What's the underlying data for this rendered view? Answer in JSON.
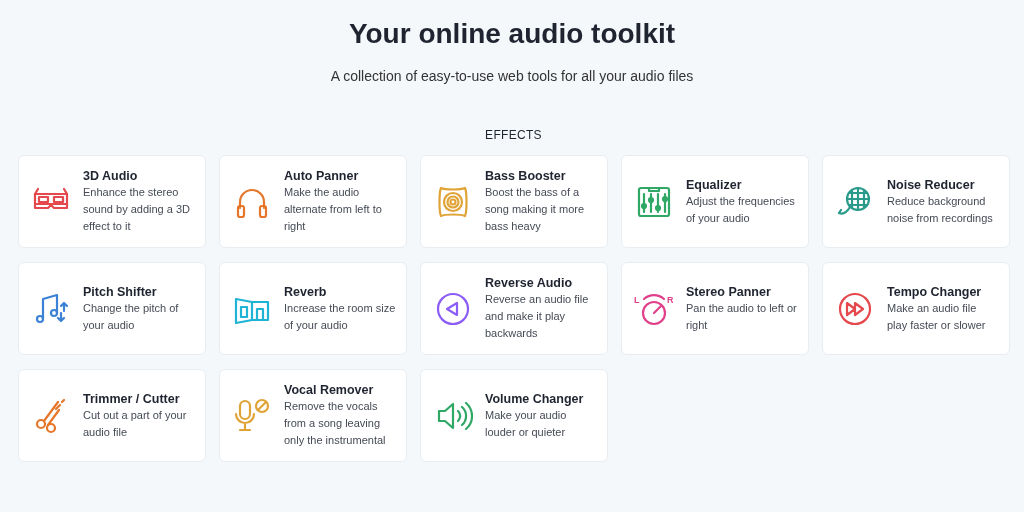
{
  "header": {
    "title": "Your online audio toolkit",
    "subtitle": "A collection of easy-to-use web tools for all your audio files"
  },
  "section": {
    "heading": "EFFECTS",
    "tools": [
      {
        "name": "3D Audio",
        "description": "Enhance the stereo sound by adding a 3D effect to it",
        "kind": "glasses",
        "color": "#e5484d"
      },
      {
        "name": "Auto Panner",
        "description": "Make the audio alternate from left to right",
        "kind": "headphones",
        "color": "#e5762a"
      },
      {
        "name": "Bass Booster",
        "description": "Boost the bass of a song making it more bass heavy",
        "kind": "speaker",
        "color": "#e0a336"
      },
      {
        "name": "Equalizer",
        "description": "Adjust the frequencies of your audio",
        "kind": "mixer",
        "color": "#2fa866"
      },
      {
        "name": "Noise Reducer",
        "description": "Reduce background noise from recordings",
        "kind": "mic-grid",
        "color": "#2a9a8a"
      },
      {
        "name": "Pitch Shifter",
        "description": "Change the pitch of your audio",
        "kind": "notes",
        "color": "#3b82d6"
      },
      {
        "name": "Reverb",
        "description": "Increase the room size of your audio",
        "kind": "room",
        "color": "#1fb3d6"
      },
      {
        "name": "Reverse Audio",
        "description": "Reverse an audio file and make it play backwards",
        "kind": "reverse",
        "color": "#8b5cf6"
      },
      {
        "name": "Stereo Panner",
        "description": "Pan the audio to left or right",
        "kind": "dial",
        "color": "#e0408a",
        "marks": [
          "L",
          "R"
        ]
      },
      {
        "name": "Tempo Changer",
        "description": "Make an audio file play faster or slower",
        "kind": "forward",
        "color": "#e5484d"
      },
      {
        "name": "Trimmer / Cutter",
        "description": "Cut out a part of your audio file",
        "kind": "scissors",
        "color": "#e5762a"
      },
      {
        "name": "Vocal Remover",
        "description": "Remove the vocals from a song leaving only the instrumental",
        "kind": "mic-off",
        "color": "#e0a336"
      },
      {
        "name": "Volume Changer",
        "description": "Make your audio louder or quieter",
        "kind": "volume",
        "color": "#2fa866"
      }
    ]
  }
}
